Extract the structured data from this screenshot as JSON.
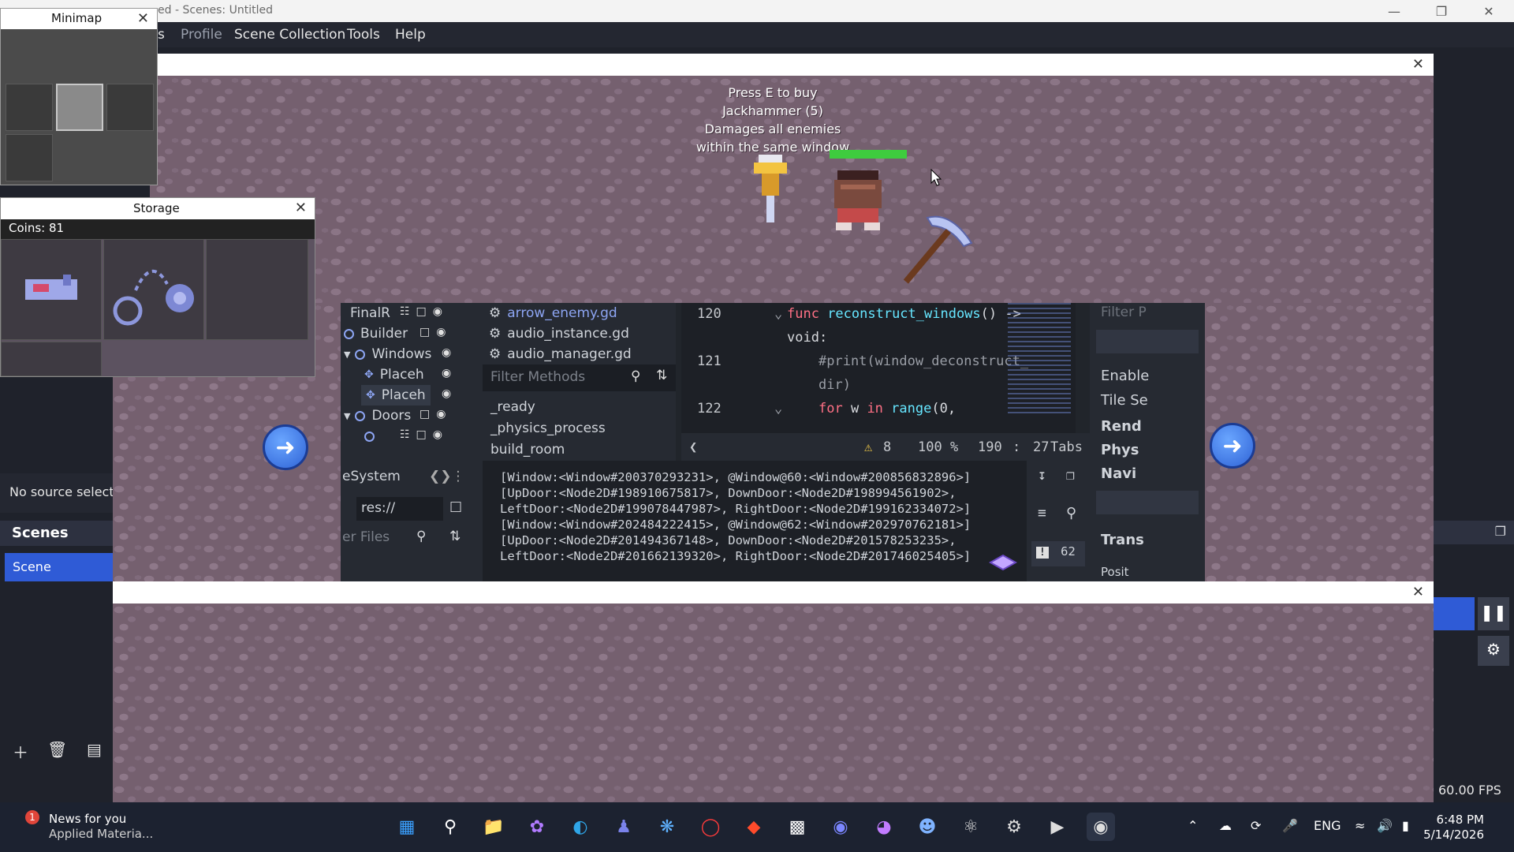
{
  "obs": {
    "title": "ed - Scenes: Untitled",
    "menu": [
      "s",
      "Profile",
      "Scene Collection",
      "Tools",
      "Help"
    ],
    "no_source": "No source selecte",
    "scenes_header": "Scenes",
    "scene_item": "Scene",
    "fps": "60.00 FPS"
  },
  "minimap": {
    "title": "Minimap"
  },
  "storage": {
    "title": "Storage",
    "coins": "Coins: 81"
  },
  "game": {
    "shop_lines": [
      "Press E to buy",
      "Jackhammer (5)",
      "Damages all enemies",
      "within the same window"
    ],
    "health_fraction": 1.0
  },
  "godot": {
    "scene_tree": [
      {
        "label": "FinalR",
        "icon": "circle"
      },
      {
        "label": "Builder",
        "icon": "circle"
      },
      {
        "label": "Windows",
        "icon": "circle"
      },
      {
        "label": "Placeh",
        "icon": "cross"
      },
      {
        "label": "Placeh",
        "icon": "cross"
      },
      {
        "label": "Doors",
        "icon": "circle"
      }
    ],
    "scripts": [
      "arrow_enemy.gd",
      "audio_instance.gd",
      "audio_manager.gd"
    ],
    "filter_methods_placeholder": "Filter Methods",
    "methods": [
      "_ready",
      "_physics_process",
      "build_room"
    ],
    "filesystem_tab": "eSystem",
    "res_path": "res://",
    "filter_files_placeholder": "er Files",
    "code": [
      {
        "line": "120",
        "parts": [
          [
            "kw",
            "func "
          ],
          [
            "fn",
            "reconstruct_windows"
          ],
          [
            "tx",
            "() ->"
          ]
        ]
      },
      {
        "line": "",
        "parts": [
          [
            "tx",
            "void:"
          ]
        ]
      },
      {
        "line": "121",
        "parts": [
          [
            "cm",
            "#print(window_deconstruct_"
          ]
        ]
      },
      {
        "line": "",
        "parts": [
          [
            "cm",
            "dir)"
          ]
        ]
      },
      {
        "line": "122",
        "parts": [
          [
            "kw",
            "for "
          ],
          [
            "tx",
            "w "
          ],
          [
            "kw",
            "in "
          ],
          [
            "fn",
            "range"
          ],
          [
            "tx",
            "(0,"
          ]
        ]
      }
    ],
    "status": {
      "warnings": "8",
      "zoom": "100 %",
      "line": "190",
      "col": "27",
      "indent": "Tabs"
    },
    "inspector": [
      "Filter P",
      "Enable",
      "Tile Se",
      "Rend",
      "Phys",
      "Navi",
      "Trans",
      "Posit"
    ],
    "output_lines": [
      "[Window:<Window#200370293231>, @Window@60:<Window#200856832896>]",
      "[UpDoor:<Node2D#198910675817>, DownDoor:<Node2D#198994561902>,",
      "LeftDoor:<Node2D#199078447987>, RightDoor:<Node2D#199162334072>]",
      "[Window:<Window#202484222415>, @Window@62:<Window#202970762181>]",
      "[UpDoor:<Node2D#201494367148>, DownDoor:<Node2D#201578253235>,",
      "LeftDoor:<Node2D#201662139320>, RightDoor:<Node2D#201746025405>]"
    ],
    "output_count": "62"
  },
  "taskbar": {
    "news_title": "News for you",
    "news_sub": "Applied Materia...",
    "news_badge": "1",
    "lang": "ENG",
    "time": "6:48 PM",
    "date": "5/14/2026"
  }
}
